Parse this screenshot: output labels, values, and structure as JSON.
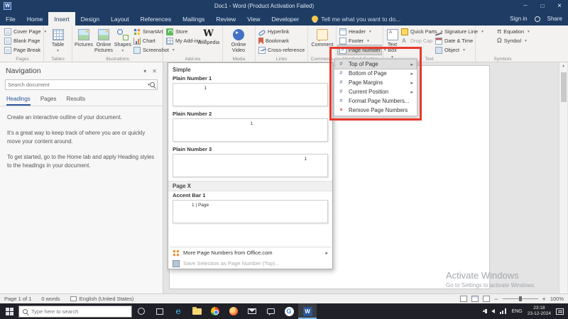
{
  "titlebar": {
    "title": "Doc1 - Word (Product Activation Failed)"
  },
  "ribbon": {
    "tabs": [
      "File",
      "Home",
      "Insert",
      "Design",
      "Layout",
      "References",
      "Mailings",
      "Review",
      "View",
      "Developer"
    ],
    "tell_me": "Tell me what you want to do...",
    "sign_in": "Sign in",
    "share": "Share",
    "groups": {
      "pages": {
        "label": "Pages",
        "items": [
          "Cover Page",
          "Blank Page",
          "Page Break"
        ]
      },
      "tables": {
        "label": "Tables",
        "table": "Table"
      },
      "illustrations": {
        "label": "Illustrations",
        "pictures": "Pictures",
        "online_pictures": "Online Pictures",
        "shapes": "Shapes",
        "smartart": "SmartArt",
        "chart": "Chart",
        "screenshot": "Screenshot"
      },
      "addins": {
        "label": "Add-ins",
        "store": "Store",
        "my_addins": "My Add-ins",
        "wikipedia": "Wikipedia",
        "wikipedia_glyph": "W"
      },
      "media": {
        "label": "Media",
        "online_video": "Online Video"
      },
      "links": {
        "label": "Links",
        "items": [
          "Hyperlink",
          "Bookmark",
          "Cross-reference"
        ]
      },
      "comments": {
        "label": "Comments",
        "comment": "Comment"
      },
      "header_footer": {
        "label": "Header & Footer",
        "header": "Header",
        "footer": "Footer",
        "page_number": "Page Number"
      },
      "text": {
        "label": "Text",
        "text_box": "Text Box",
        "quick_parts": "Quick Parts",
        "drop_cap": "Drop Cap",
        "signature_line": "Signature Line",
        "date_time": "Date & Time",
        "object": "Object"
      },
      "symbols": {
        "label": "Symbols",
        "equation": "Equation",
        "symbol": "Symbol",
        "equation_glyph": "π",
        "symbol_glyph": "Ω"
      }
    }
  },
  "navigation": {
    "title": "Navigation",
    "search_placeholder": "Search document",
    "tabs": [
      "Headings",
      "Pages",
      "Results"
    ],
    "paragraphs": [
      "Create an interactive outline of your document.",
      "It's a great way to keep track of where you are or quickly move your content around.",
      "To get started, go to the Home tab and apply Heading styles to the headings in your document."
    ]
  },
  "page_number_menu": {
    "items": [
      {
        "label": "Top of Page",
        "icon": "#"
      },
      {
        "label": "Bottom of Page",
        "icon": "#"
      },
      {
        "label": "Page Margins",
        "icon": "#"
      },
      {
        "label": "Current Position",
        "icon": "#"
      },
      {
        "label": "Format Page Numbers...",
        "icon": "#"
      },
      {
        "label": "Remove Page Numbers",
        "icon": "×"
      }
    ]
  },
  "gallery": {
    "section1": "Simple",
    "items": [
      {
        "name": "Plain Number 1",
        "preview": "1"
      },
      {
        "name": "Plain Number 2",
        "preview": "1"
      },
      {
        "name": "Plain Number 3",
        "preview": "1"
      }
    ],
    "section2": "Page X",
    "accent": {
      "name": "Accent Bar 1",
      "preview": "1 | Page"
    },
    "footer": [
      "More Page Numbers from Office.com",
      "Save Selection as Page Number (Top)..."
    ]
  },
  "status_bar": {
    "page_info": "Page 1 of 1",
    "words": "0 words",
    "language": "English (United States)",
    "zoom_out": "−",
    "zoom_in": "+",
    "zoom": "100%"
  },
  "watermark": {
    "line1": "Activate Windows",
    "line2": "Go to Settings to activate Windows."
  },
  "taskbar": {
    "search_placeholder": "Type here to search",
    "tray_lang": "ENG",
    "time": "23:18",
    "date": "23-12-2024"
  },
  "colors": {
    "title_bar": "#1e3c64",
    "word_blue": "#2b579a",
    "highlight_red": "#e8392b"
  }
}
